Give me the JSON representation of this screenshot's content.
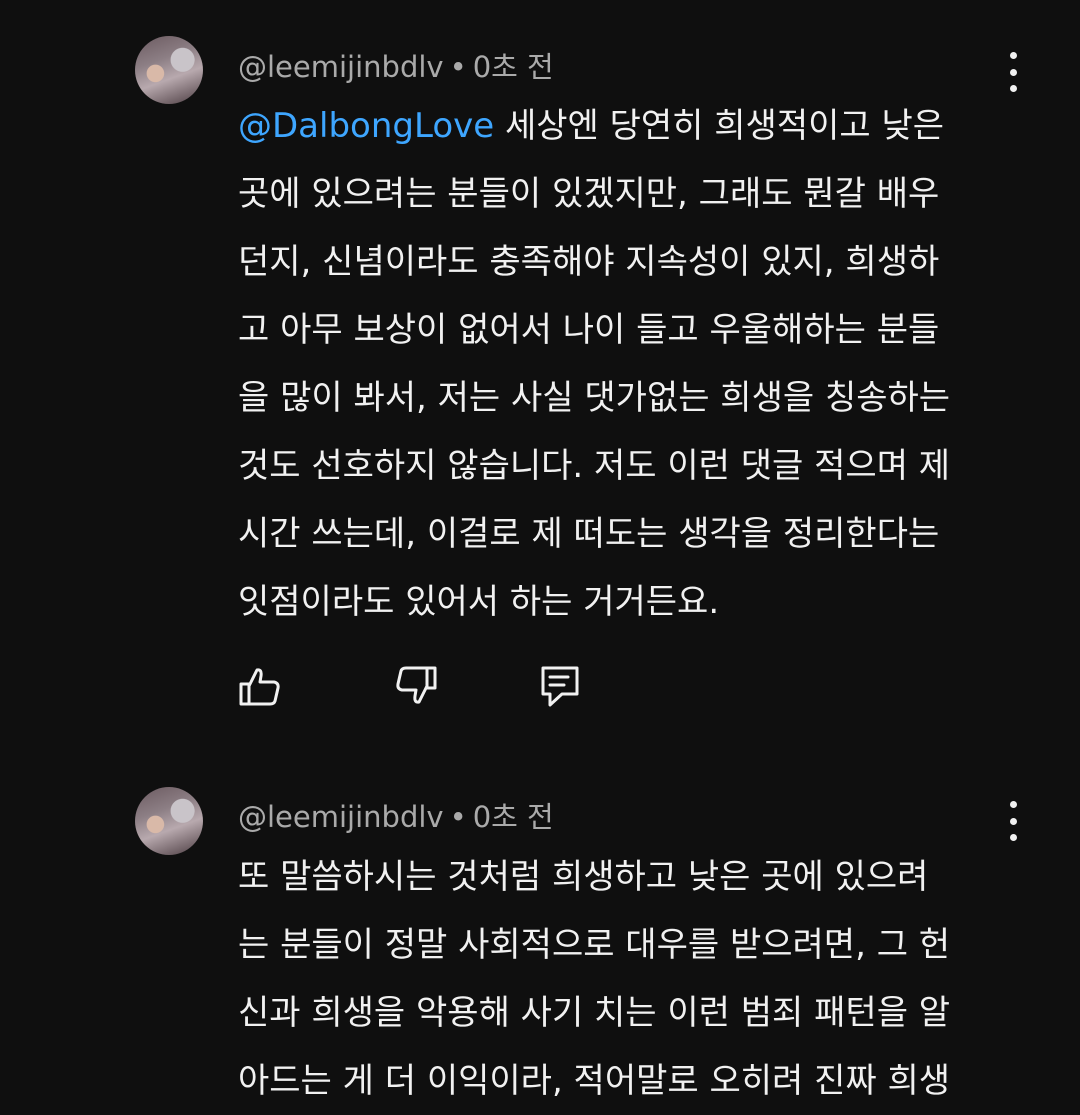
{
  "comments": [
    {
      "author": "@leemijinbdlv",
      "separator": "•",
      "time": "0초 전",
      "mention": "@DalbongLove",
      "lines": [
        " 세상엔 당연히 희생적이고 낮은",
        "곳에 있으려는 분들이 있겠지만, 그래도 뭔갈 배우",
        "던지, 신념이라도 충족해야 지속성이 있지, 희생하",
        "고 아무 보상이 없어서 나이 들고 우울해하는 분들",
        "을 많이 봐서, 저는 사실 댓가없는 희생을 칭송하는",
        "것도 선호하지 않습니다. 저도 이런 댓글 적으며 제",
        "시간 쓰는데, 이걸로 제 떠도는 생각을 정리한다는",
        "잇점이라도 있어서 하는 거거든요."
      ],
      "actions": [
        "like-icon",
        "dislike-icon",
        "reply-icon"
      ]
    },
    {
      "author": "@leemijinbdlv",
      "separator": "•",
      "time": "0초 전",
      "lines": [
        "또 말씀하시는 것처럼 희생하고 낮은 곳에 있으려",
        "는 분들이 정말 사회적으로 대우를 받으려면, 그 헌",
        "신과 희생을 악용해 사기 치는 이런 범죄 패턴을 알",
        "아드는 게 더 이익이라, 적어말로 오히려 진짜 희생"
      ]
    }
  ]
}
